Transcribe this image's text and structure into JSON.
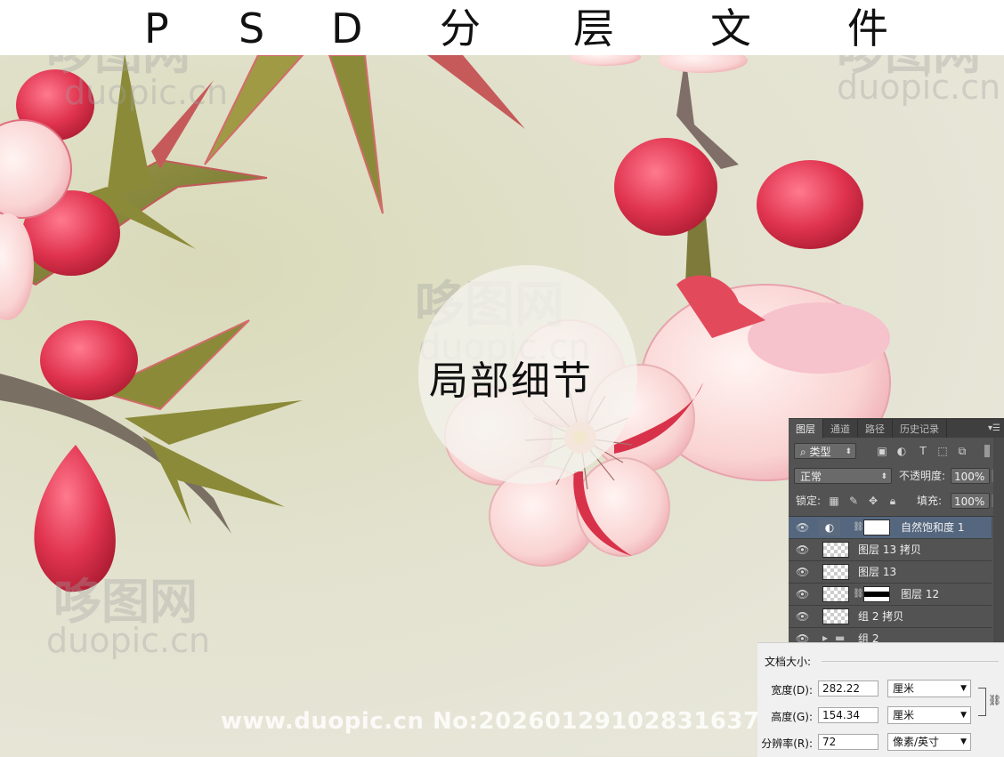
{
  "header": {
    "title_chars": [
      "P",
      "S",
      "D",
      "分",
      "层",
      "文",
      "件"
    ]
  },
  "canvas": {
    "detail_label": "局部细节",
    "watermark_logo": "哆图网",
    "watermark_domain": "duopic.cn",
    "url_watermark": "www.duopic.cn No:20260129102831637"
  },
  "layers_panel": {
    "tabs": [
      "图层",
      "通道",
      "路径",
      "历史记录"
    ],
    "active_tab": "图层",
    "filter_label": "类型",
    "blend_mode": "正常",
    "opacity_label": "不透明度:",
    "opacity_value": "100%",
    "lock_label": "锁定:",
    "fill_label": "填充:",
    "fill_value": "100%",
    "layers": [
      {
        "name": "自然饱和度 1",
        "selected": true
      },
      {
        "name": "图层 13 拷贝",
        "selected": false
      },
      {
        "name": "图层 13",
        "selected": false
      },
      {
        "name": "图层 12",
        "selected": false
      },
      {
        "name": "组 2 拷贝",
        "selected": false
      },
      {
        "name": "组 2",
        "selected": false
      }
    ]
  },
  "document_size": {
    "title": "文档大小:",
    "width_label": "宽度(D):",
    "width_value": "282.22",
    "width_unit": "厘米",
    "height_label": "高度(G):",
    "height_value": "154.34",
    "height_unit": "厘米",
    "resolution_label": "分辨率(R):",
    "resolution_value": "72",
    "resolution_unit": "像素/英寸"
  },
  "colors": {
    "panel_bg": "#535353",
    "selected_layer": "#55677f",
    "petal_red": "#e0334f",
    "petal_pink": "#f7c9cc",
    "stem_olive": "#8a8a3a"
  }
}
